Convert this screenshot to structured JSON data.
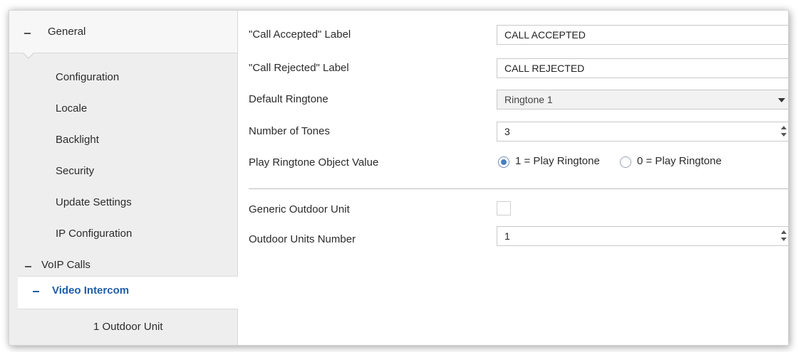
{
  "sidebar": {
    "general": "General",
    "items": [
      "Configuration",
      "Locale",
      "Backlight",
      "Security",
      "Update Settings",
      "IP Configuration"
    ],
    "voip": "VoIP Calls",
    "video_intercom": "Video Intercom",
    "outdoor_unit": "1 Outdoor Unit"
  },
  "form": {
    "call_accepted": {
      "label": "\"Call Accepted\" Label",
      "value": "CALL ACCEPTED"
    },
    "call_rejected": {
      "label": "\"Call Rejected\" Label",
      "value": "CALL REJECTED"
    },
    "default_ringtone": {
      "label": "Default Ringtone",
      "value": "Ringtone 1"
    },
    "number_of_tones": {
      "label": "Number of Tones",
      "value": "3"
    },
    "play_ringtone": {
      "label": "Play Ringtone Object Value",
      "option1": "1 = Play Ringtone",
      "option2": "0 = Play Ringtone",
      "selected": "option1"
    },
    "generic_outdoor": {
      "label": "Generic Outdoor Unit",
      "checked": false
    },
    "outdoor_units_number": {
      "label": "Outdoor Units Number",
      "value": "1"
    }
  },
  "colors": {
    "accent": "#1f5ea8",
    "sidebar_bg": "#eeeeee",
    "radio_fill": "#4a7fc0"
  }
}
